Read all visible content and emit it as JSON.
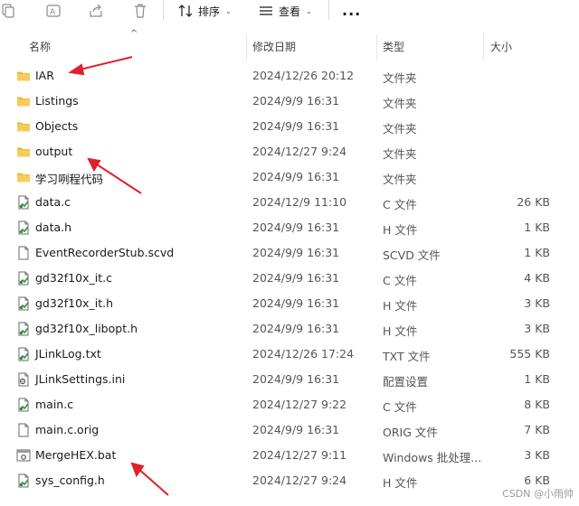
{
  "toolbar": {
    "sort_label": "排序",
    "view_label": "查看",
    "more_label": "..."
  },
  "columns": {
    "name": "名称",
    "date": "修改日期",
    "type": "类型",
    "size": "大小"
  },
  "files": [
    {
      "name": "IAR",
      "date": "2024/12/26 20:12",
      "type": "文件夹",
      "size": "",
      "icon": "folder-icon"
    },
    {
      "name": "Listings",
      "date": "2024/9/9 16:31",
      "type": "文件夹",
      "size": "",
      "icon": "folder-icon"
    },
    {
      "name": "Objects",
      "date": "2024/9/9 16:31",
      "type": "文件夹",
      "size": "",
      "icon": "folder-icon"
    },
    {
      "name": "output",
      "date": "2024/12/27 9:24",
      "type": "文件夹",
      "size": "",
      "icon": "folder-icon"
    },
    {
      "name": "学习咧程代码",
      "date": "2024/9/9 16:31",
      "type": "文件夹",
      "size": "",
      "icon": "folder-icon"
    },
    {
      "name": "data.c",
      "date": "2024/12/9 11:10",
      "type": "C 文件",
      "size": "26 KB",
      "icon": "source-file-icon"
    },
    {
      "name": "data.h",
      "date": "2024/9/9 16:31",
      "type": "H 文件",
      "size": "1 KB",
      "icon": "source-file-icon"
    },
    {
      "name": "EventRecorderStub.scvd",
      "date": "2024/9/9 16:31",
      "type": "SCVD 文件",
      "size": "1 KB",
      "icon": "blank-file-icon"
    },
    {
      "name": "gd32f10x_it.c",
      "date": "2024/9/9 16:31",
      "type": "C 文件",
      "size": "4 KB",
      "icon": "source-file-icon"
    },
    {
      "name": "gd32f10x_it.h",
      "date": "2024/9/9 16:31",
      "type": "H 文件",
      "size": "3 KB",
      "icon": "source-file-icon"
    },
    {
      "name": "gd32f10x_libopt.h",
      "date": "2024/9/9 16:31",
      "type": "H 文件",
      "size": "3 KB",
      "icon": "source-file-icon"
    },
    {
      "name": "JLinkLog.txt",
      "date": "2024/12/26 17:24",
      "type": "TXT 文件",
      "size": "555 KB",
      "icon": "source-file-icon"
    },
    {
      "name": "JLinkSettings.ini",
      "date": "2024/9/9 16:31",
      "type": "配置设置",
      "size": "1 KB",
      "icon": "settings-file-icon"
    },
    {
      "name": "main.c",
      "date": "2024/12/27 9:22",
      "type": "C 文件",
      "size": "8 KB",
      "icon": "source-file-icon"
    },
    {
      "name": "main.c.orig",
      "date": "2024/9/9 16:31",
      "type": "ORIG 文件",
      "size": "7 KB",
      "icon": "blank-file-icon"
    },
    {
      "name": "MergeHEX.bat",
      "date": "2024/12/27 9:11",
      "type": "Windows 批处理...",
      "size": "3 KB",
      "icon": "batch-file-icon"
    },
    {
      "name": "sys_config.h",
      "date": "2024/12/27 9:24",
      "type": "H 文件",
      "size": "6 KB",
      "icon": "source-file-icon"
    }
  ],
  "watermark": "CSDN @小雨帅",
  "colors": {
    "annotation_arrow": "#e0202a",
    "folder": "#f5c04a",
    "header_text": "#444444"
  }
}
